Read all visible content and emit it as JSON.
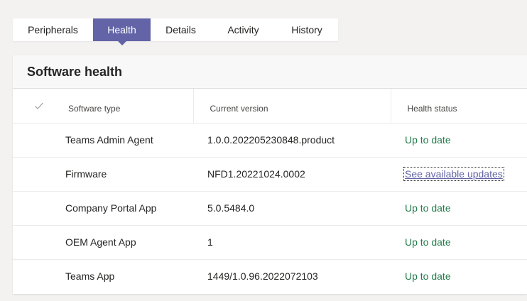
{
  "tabs": [
    {
      "label": "Peripherals",
      "active": false
    },
    {
      "label": "Health",
      "active": true
    },
    {
      "label": "Details",
      "active": false
    },
    {
      "label": "Activity",
      "active": false
    },
    {
      "label": "History",
      "active": false
    }
  ],
  "card": {
    "title": "Software health"
  },
  "table": {
    "columns": [
      "Software type",
      "Current version",
      "Health status"
    ],
    "select_all_icon": "checkmark-icon",
    "rows": [
      {
        "type": "Teams Admin Agent",
        "version": "1.0.0.202205230848.product",
        "status": "Up to date",
        "status_kind": "ok"
      },
      {
        "type": "Firmware",
        "version": "NFD1.20221024.0002",
        "status": "See available updates",
        "status_kind": "link"
      },
      {
        "type": "Company Portal App",
        "version": "5.0.5484.0",
        "status": "Up to date",
        "status_kind": "ok"
      },
      {
        "type": "OEM Agent App",
        "version": "1",
        "status": "Up to date",
        "status_kind": "ok"
      },
      {
        "type": "Teams App",
        "version": "1449/1.0.96.2022072103",
        "status": "Up to date",
        "status_kind": "ok"
      }
    ]
  },
  "colors": {
    "accent": "#6264a7",
    "status_ok": "#237b4b",
    "background": "#f3f2f1"
  }
}
